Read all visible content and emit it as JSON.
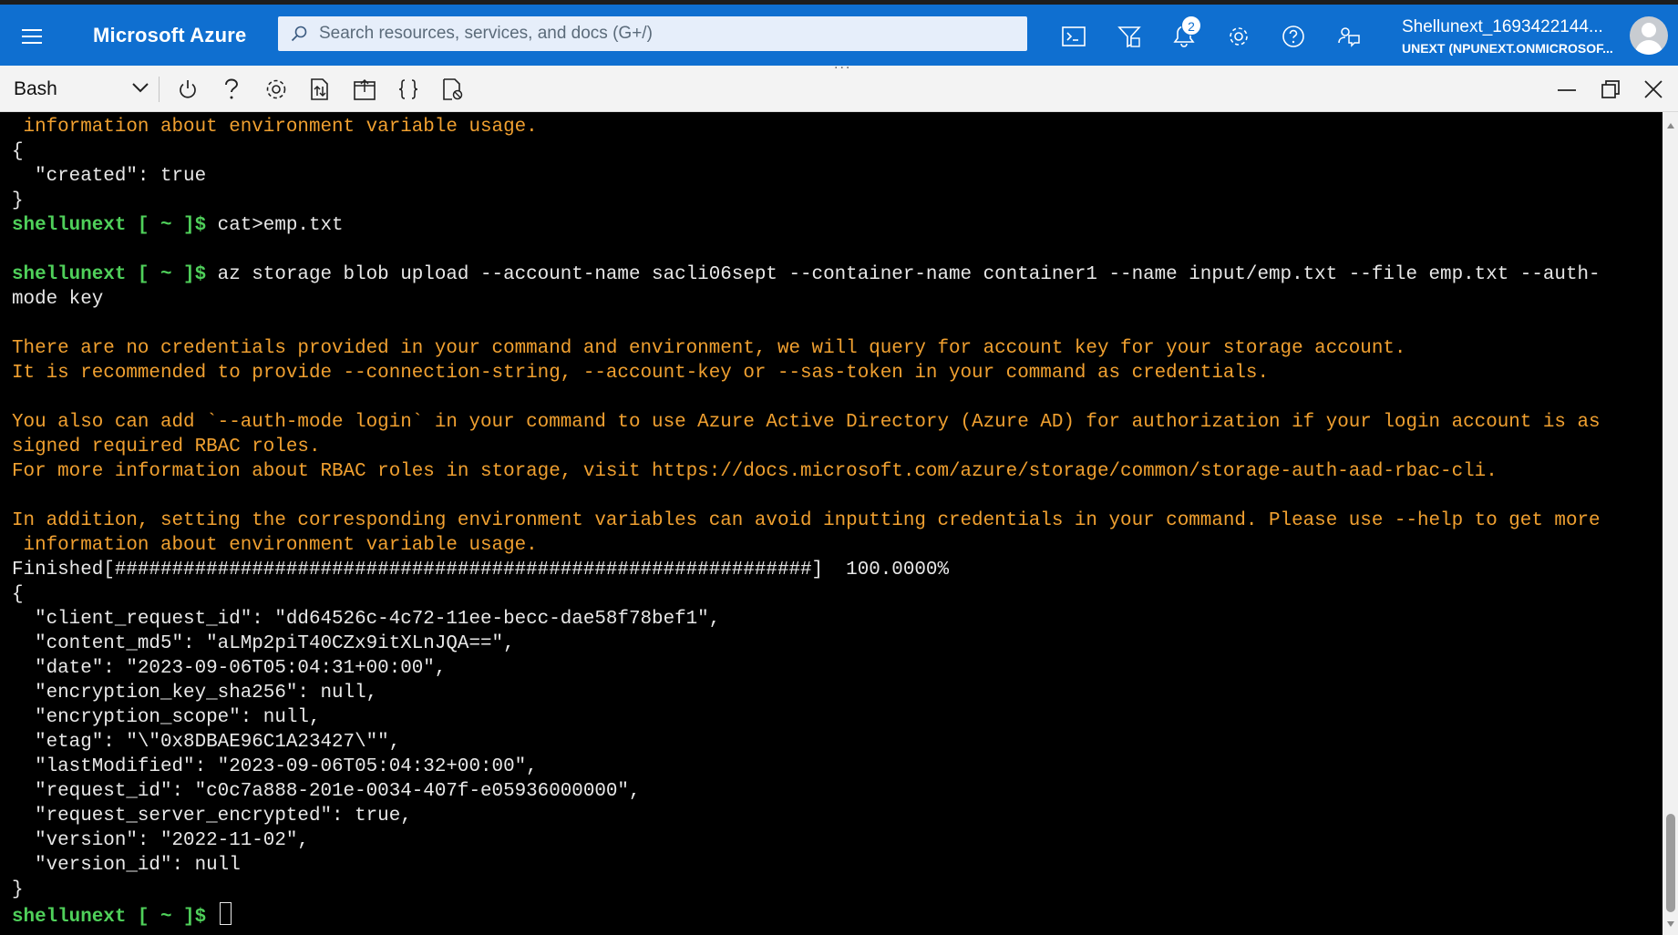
{
  "topbar": {
    "brand": "Microsoft Azure",
    "search_placeholder": "Search resources, services, and docs (G+/)",
    "notification_count": "2",
    "account_name": "Shellunext_1693422144...",
    "account_tenant": "UNEXT (NPUNEXT.ONMICROSOF...",
    "resize_grip": "...",
    "accent_color": "#0f6fd0"
  },
  "toolbar": {
    "shell_type": "Bash",
    "icons": [
      "power-icon",
      "help-icon",
      "settings-icon",
      "upload-download-icon",
      "open-new-session-icon",
      "editor-braces-icon",
      "web-preview-icon"
    ]
  },
  "terminal": {
    "lines": [
      {
        "segments": [
          {
            "text": " information about environment variable usage.",
            "style": "warn"
          }
        ]
      },
      {
        "segments": [
          {
            "text": "{",
            "style": "plain"
          }
        ]
      },
      {
        "segments": [
          {
            "text": "  \"created\": true",
            "style": "plain"
          }
        ]
      },
      {
        "segments": [
          {
            "text": "}",
            "style": "plain"
          }
        ]
      },
      {
        "segments": [
          {
            "text": "shellunext [ ~ ]$ ",
            "style": "prompt"
          },
          {
            "text": "cat>emp.txt",
            "style": "plain"
          }
        ]
      },
      {
        "segments": []
      },
      {
        "segments": [
          {
            "text": "shellunext [ ~ ]$ ",
            "style": "prompt"
          },
          {
            "text": "az storage blob upload --account-name sacli06sept --container-name container1 --name input/emp.txt --file emp.txt --auth-",
            "style": "plain"
          }
        ]
      },
      {
        "segments": [
          {
            "text": "mode key",
            "style": "plain"
          }
        ]
      },
      {
        "segments": []
      },
      {
        "segments": [
          {
            "text": "There are no credentials provided in your command and environment, we will query for account key for your storage account.",
            "style": "warn"
          }
        ]
      },
      {
        "segments": [
          {
            "text": "It is recommended to provide --connection-string, --account-key or --sas-token in your command as credentials.",
            "style": "warn"
          }
        ]
      },
      {
        "segments": []
      },
      {
        "segments": [
          {
            "text": "You also can add `--auth-mode login` in your command to use Azure Active Directory (Azure AD) for authorization if your login account is as",
            "style": "warn"
          }
        ]
      },
      {
        "segments": [
          {
            "text": "signed required RBAC roles.",
            "style": "warn"
          }
        ]
      },
      {
        "segments": [
          {
            "text": "For more information about RBAC roles in storage, visit https://docs.microsoft.com/azure/storage/common/storage-auth-aad-rbac-cli.",
            "style": "warn"
          }
        ]
      },
      {
        "segments": []
      },
      {
        "segments": [
          {
            "text": "In addition, setting the corresponding environment variables can avoid inputting credentials in your command. Please use --help to get more",
            "style": "warn"
          }
        ]
      },
      {
        "segments": [
          {
            "text": " information about environment variable usage.",
            "style": "warn"
          }
        ]
      },
      {
        "segments": [
          {
            "text": "Finished[#############################################################]  100.0000%",
            "style": "plain"
          }
        ]
      },
      {
        "segments": [
          {
            "text": "{",
            "style": "plain"
          }
        ]
      },
      {
        "segments": [
          {
            "text": "  \"client_request_id\": \"dd64526c-4c72-11ee-becc-dae58f78bef1\",",
            "style": "plain"
          }
        ]
      },
      {
        "segments": [
          {
            "text": "  \"content_md5\": \"aLMp2piT40CZx9itXLnJQA==\",",
            "style": "plain"
          }
        ]
      },
      {
        "segments": [
          {
            "text": "  \"date\": \"2023-09-06T05:04:31+00:00\",",
            "style": "plain"
          }
        ]
      },
      {
        "segments": [
          {
            "text": "  \"encryption_key_sha256\": null,",
            "style": "plain"
          }
        ]
      },
      {
        "segments": [
          {
            "text": "  \"encryption_scope\": null,",
            "style": "plain"
          }
        ]
      },
      {
        "segments": [
          {
            "text": "  \"etag\": \"\\\"0x8DBAE96C1A23427\\\"\",",
            "style": "plain"
          }
        ]
      },
      {
        "segments": [
          {
            "text": "  \"lastModified\": \"2023-09-06T05:04:32+00:00\",",
            "style": "plain"
          }
        ]
      },
      {
        "segments": [
          {
            "text": "  \"request_id\": \"c0c7a888-201e-0034-407f-e05936000000\",",
            "style": "plain"
          }
        ]
      },
      {
        "segments": [
          {
            "text": "  \"request_server_encrypted\": true,",
            "style": "plain"
          }
        ]
      },
      {
        "segments": [
          {
            "text": "  \"version\": \"2022-11-02\",",
            "style": "plain"
          }
        ]
      },
      {
        "segments": [
          {
            "text": "  \"version_id\": null",
            "style": "plain"
          }
        ]
      },
      {
        "segments": [
          {
            "text": "}",
            "style": "plain"
          }
        ]
      },
      {
        "segments": [
          {
            "text": "shellunext [ ~ ]$ ",
            "style": "prompt"
          }
        ],
        "cursor": true
      }
    ],
    "colors": {
      "background": "#000000",
      "text": "#e8e8e8",
      "prompt": "#4fd05a",
      "warning": "#f0a030"
    }
  }
}
